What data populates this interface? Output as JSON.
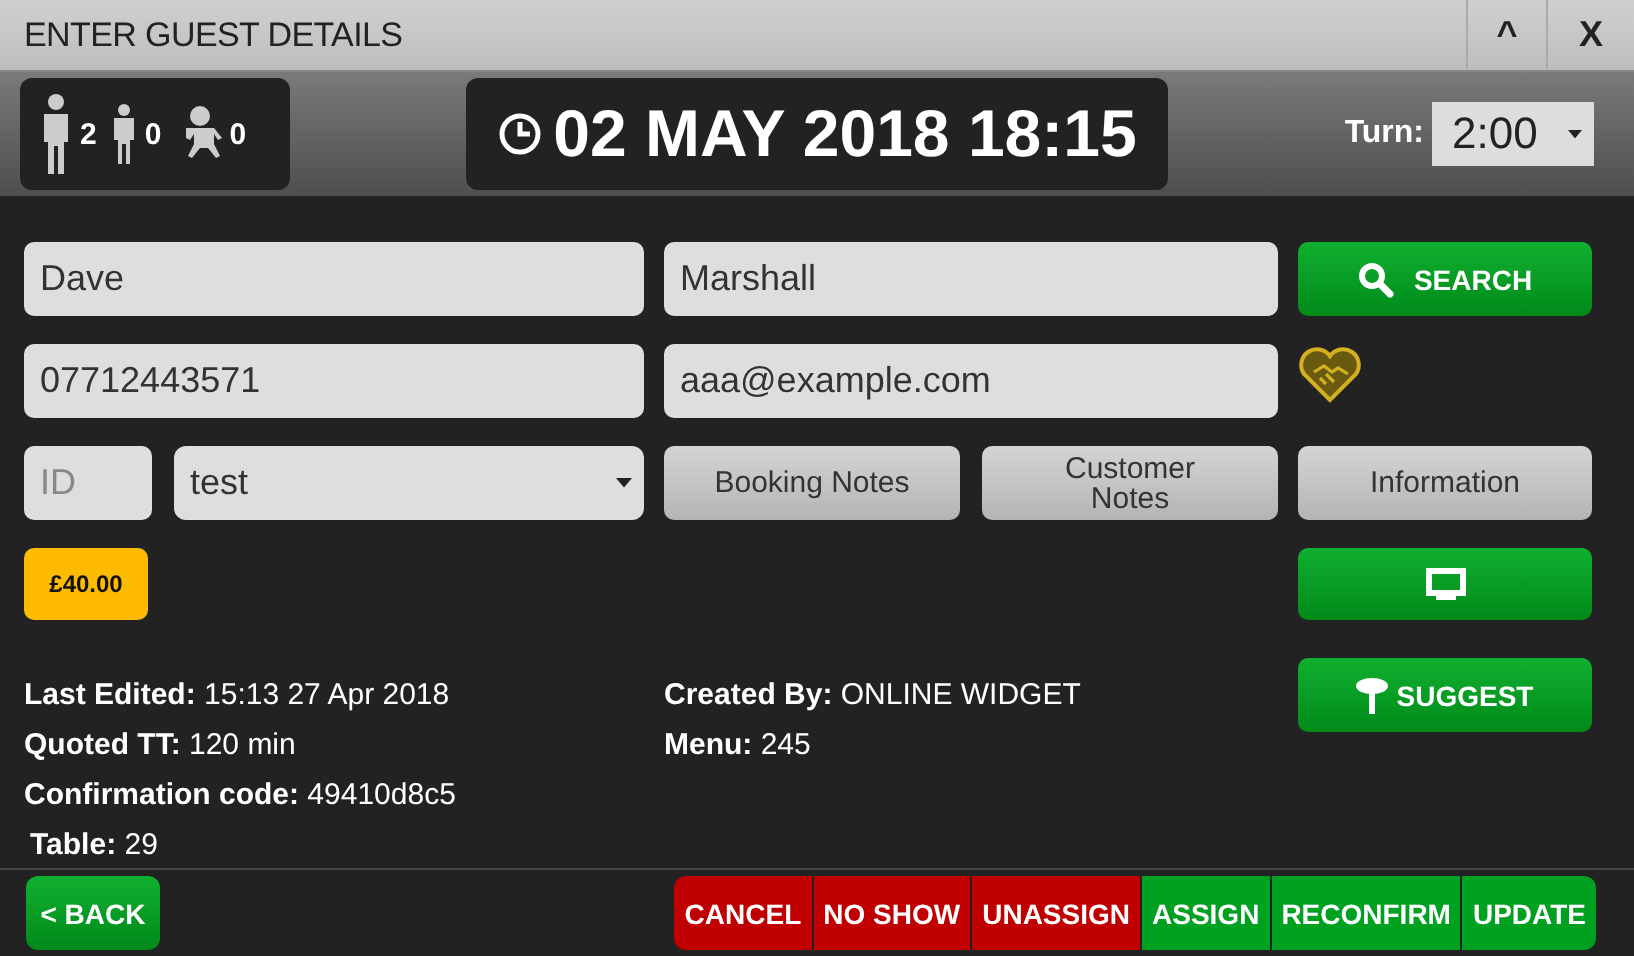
{
  "window": {
    "title": "ENTER GUEST DETAILS",
    "collapse": "^",
    "close": "X"
  },
  "party": [
    {
      "kind": "adult",
      "count": "2"
    },
    {
      "kind": "child",
      "count": "0"
    },
    {
      "kind": "baby",
      "count": "0"
    }
  ],
  "datetime": "02 MAY 2018 18:15",
  "turn": {
    "label": "Turn:",
    "value": "2:00"
  },
  "form": {
    "first_name": "Dave",
    "last_name": "Marshall",
    "phone": "07712443571",
    "email": "aaa@example.com",
    "id": {
      "placeholder": "ID"
    },
    "source": "test"
  },
  "buttons": {
    "search": "SEARCH",
    "booking_notes": "Booking Notes",
    "customer_notes": "Customer Notes",
    "information": "Information",
    "suggest": "SUGGEST"
  },
  "deposit": "£40.00",
  "details_left": [
    "**Last Edited:** 15:13 27 Apr 2018",
    "**Quoted TT:** 120 min",
    "**Confirmation code:** 49410d8c5",
    "**Table:** 29"
  ],
  "details_right": [
    "**Created By:** ONLINE WIDGET",
    "**Menu:** 245"
  ],
  "back": "< BACK",
  "actions": [
    {
      "label": "CANCEL",
      "color": "#c00000"
    },
    {
      "label": "NO SHOW",
      "color": "#c00000"
    },
    {
      "label": "UNASSIGN",
      "color": "#c00000"
    },
    {
      "label": "ASSIGN",
      "color": "#00a020"
    },
    {
      "label": "RECONFIRM",
      "color": "#00a020"
    },
    {
      "label": "UPDATE",
      "color": "#00a020"
    }
  ]
}
